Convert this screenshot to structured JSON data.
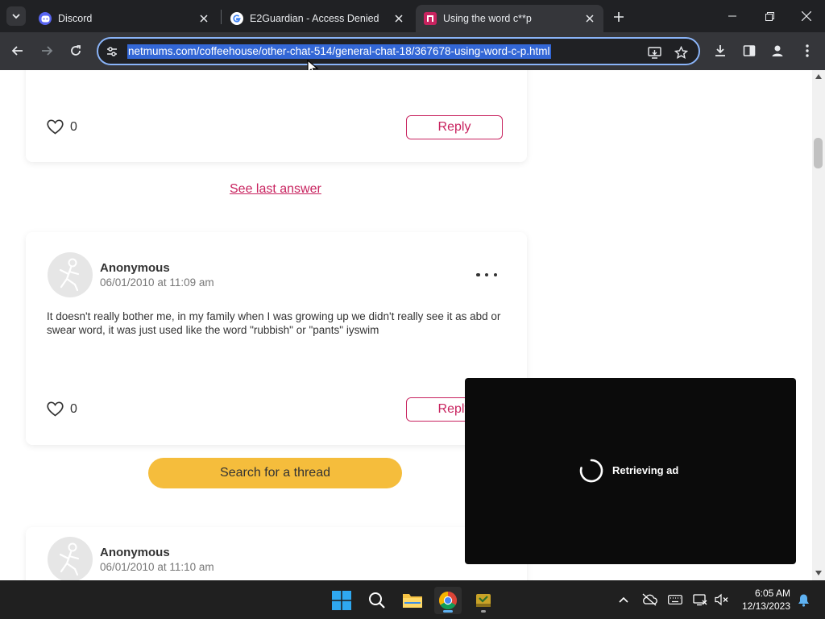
{
  "browser": {
    "tabs": [
      {
        "title": "Discord",
        "active": false
      },
      {
        "title": "E2Guardian - Access Denied",
        "active": false
      },
      {
        "title": "Using the word c**p",
        "active": true
      }
    ],
    "url": "netmums.com/coffeehouse/other-chat-514/general-chat-18/367678-using-word-c-p.html"
  },
  "page": {
    "post_top": {
      "likes": "0",
      "reply_label": "Reply"
    },
    "see_last_answer": "See last answer",
    "post_1": {
      "author": "Anonymous",
      "date": "06/01/2010 at 11:09 am",
      "text": "It doesn't really bother me, in my family when I was growing up we didn't really see it as abd or swear word, it was just used like the word \"rubbish\" or \"pants\" iyswim",
      "likes": "0",
      "reply_label": "Reply"
    },
    "search_thread_label": "Search for a thread",
    "post_2": {
      "author": "Anonymous",
      "date": "06/01/2010 at 11:10 am"
    },
    "ad": {
      "status_text": "Retrieving ad"
    }
  },
  "taskbar": {
    "time": "6:05 AM",
    "date": "12/13/2023"
  },
  "colors": {
    "accent_pink": "#c8235f",
    "search_button": "#f5bd3c",
    "chrome_dark": "#202124",
    "chrome_toolbar": "#35363a",
    "url_selection": "#3367d6"
  }
}
